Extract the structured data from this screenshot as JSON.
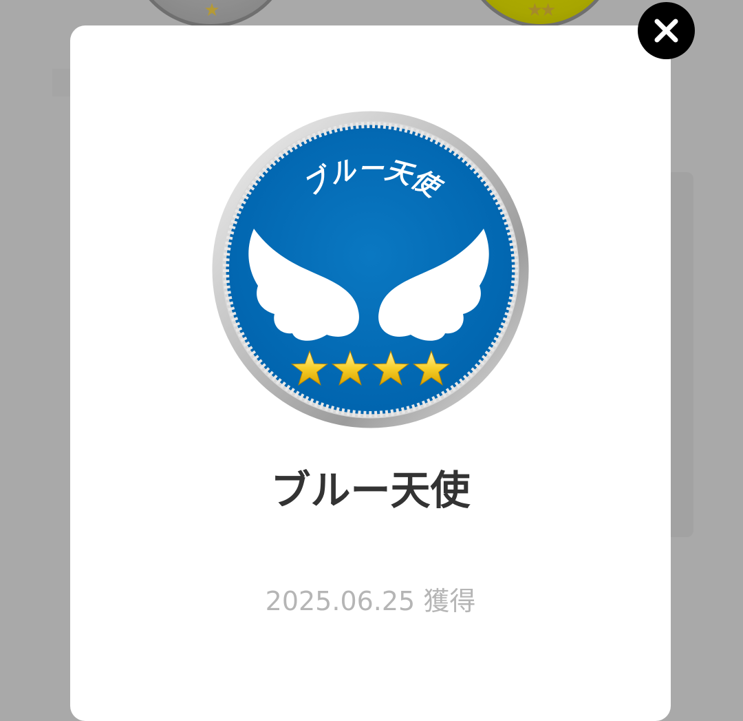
{
  "badge": {
    "name": "ブルー天使",
    "emblem_text": "ブルー天使",
    "stars": 4,
    "acquired_date": "2025.06.25",
    "acquired_label": "獲得",
    "colors": {
      "face": "#0070bb",
      "rim": "#cfcfcf",
      "wings": "#ffffff",
      "stars": "#f5c518"
    }
  },
  "background": {
    "coin_left_stars": "★",
    "coin_right_stars": "★★"
  },
  "close_icon": "close-icon",
  "colors": {
    "overlay": "#a9a9a9",
    "modal": "#ffffff",
    "title_text": "#333333",
    "date_text": "#b5b5b5",
    "close_button": "#000000"
  }
}
